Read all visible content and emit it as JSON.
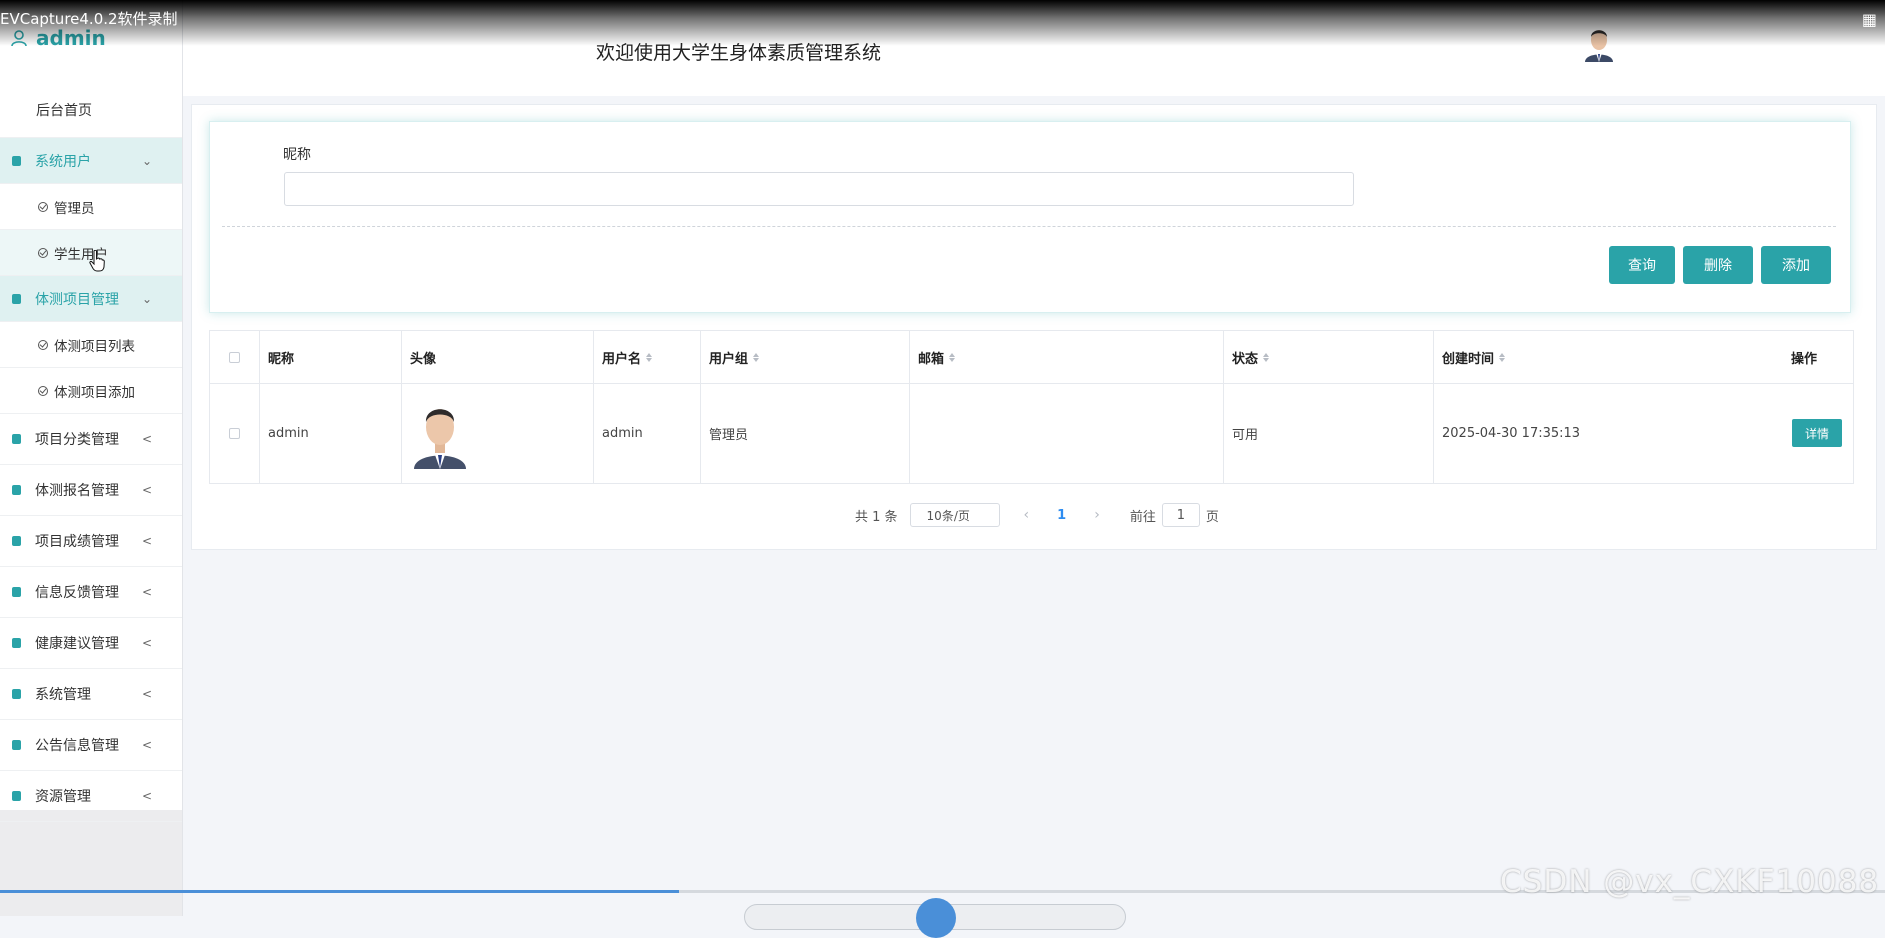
{
  "recording": {
    "title": "EVCapture4.0.2软件录制",
    "icon": "fullscreen-icon"
  },
  "sidebar": {
    "username": "admin",
    "user_icon": "user-icon",
    "home": "后台首页",
    "groups": [
      {
        "label": "系统用户",
        "open": true,
        "children": [
          "管理员",
          "学生用户"
        ],
        "active_child": "学生用户"
      },
      {
        "label": "体测项目管理",
        "open": true,
        "children": [
          "体测项目列表",
          "体测项目添加"
        ]
      },
      {
        "label": "项目分类管理",
        "open": false
      },
      {
        "label": "体测报名管理",
        "open": false
      },
      {
        "label": "项目成绩管理",
        "open": false
      },
      {
        "label": "信息反馈管理",
        "open": false
      },
      {
        "label": "健康建议管理",
        "open": false
      },
      {
        "label": "系统管理",
        "open": false
      },
      {
        "label": "公告信息管理",
        "open": false
      },
      {
        "label": "资源管理",
        "open": false
      }
    ]
  },
  "header": {
    "title": "欢迎使用大学生身体素质管理系统",
    "avatar": "avatar"
  },
  "search": {
    "nickname_label": "昵称",
    "nickname_value": "",
    "query_button": "查询",
    "delete_button": "删除",
    "add_button": "添加"
  },
  "table": {
    "headers": [
      "昵称",
      "头像",
      "用户名",
      "用户组",
      "邮箱",
      "状态",
      "创建时间",
      "操作"
    ],
    "rows": [
      {
        "nickname": "admin",
        "username": "admin",
        "group": "管理员",
        "email": "",
        "status": "可用",
        "created": "2025-04-30 17:35:13",
        "action": "详情"
      }
    ]
  },
  "pagination": {
    "total": "共 1 条",
    "page_size": "10条/页",
    "current": "1",
    "goto_prefix": "前往",
    "goto_value": "1",
    "goto_suffix": "页"
  },
  "player": {
    "progress": 0.36
  },
  "watermark": "CSDN @vx_CXKF10088",
  "colors": {
    "accent": "#2aa3a8",
    "page_link": "#2d8cf0"
  }
}
